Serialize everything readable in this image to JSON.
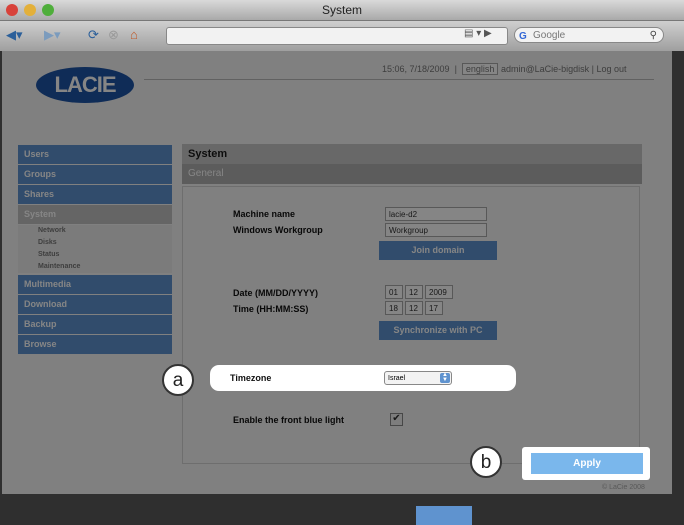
{
  "window": {
    "title": "System"
  },
  "browser": {
    "search_placeholder": "Google"
  },
  "header": {
    "logo": "LACIE",
    "datetime": "15:06, 7/18/2009",
    "language": "english",
    "account": "admin@LaCie-bigdisk | Log out"
  },
  "sidebar": {
    "items": [
      {
        "label": "Users"
      },
      {
        "label": "Groups"
      },
      {
        "label": "Shares"
      },
      {
        "label": "System"
      },
      {
        "label": "Network"
      },
      {
        "label": "Disks"
      },
      {
        "label": "Status"
      },
      {
        "label": "Maintenance"
      },
      {
        "label": "Multimedia"
      },
      {
        "label": "Download"
      },
      {
        "label": "Backup"
      },
      {
        "label": "Browse"
      }
    ]
  },
  "panel": {
    "title": "System",
    "subtitle": "General",
    "machine_name_label": "Machine name",
    "machine_name_value": "lacie-d2",
    "workgroup_label": "Windows Workgroup",
    "workgroup_value": "Workgroup",
    "join_domain_label": "Join domain",
    "date_label": "Date (MM/DD/YYYY)",
    "date": {
      "month": "01",
      "day": "12",
      "year": "2009"
    },
    "time_label": "Time (HH:MM:SS)",
    "time": {
      "hh": "18",
      "mm": "12",
      "ss": "17"
    },
    "sync_label": "Synchronize with PC",
    "timezone_label": "Timezone",
    "timezone_value": "Israel",
    "front_light_label": "Enable the front blue light",
    "front_light_checked": "✔",
    "apply_label": "Apply"
  },
  "callouts": {
    "a": "a",
    "b": "b"
  },
  "footer": {
    "copyright": "© LaCie 2008"
  }
}
